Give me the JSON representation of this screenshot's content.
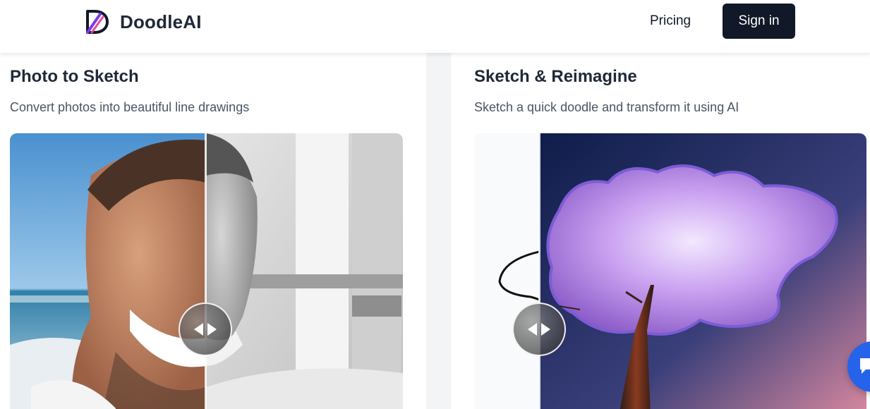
{
  "header": {
    "brand_name": "DoodleAI",
    "pricing_label": "Pricing",
    "signin_label": "Sign in"
  },
  "panels": [
    {
      "title": "Photo to Sketch",
      "subtitle": "Convert photos into beautiful line drawings"
    },
    {
      "title": "Sketch & Reimagine",
      "subtitle": "Sketch a quick doodle and transform it using AI"
    }
  ],
  "colors": {
    "primary_dark": "#111827",
    "chat_blue": "#2563eb",
    "text_muted": "#4b5563"
  },
  "icons": [
    "doodleai-logo-icon",
    "compare-handle-icon",
    "chat-icon"
  ]
}
